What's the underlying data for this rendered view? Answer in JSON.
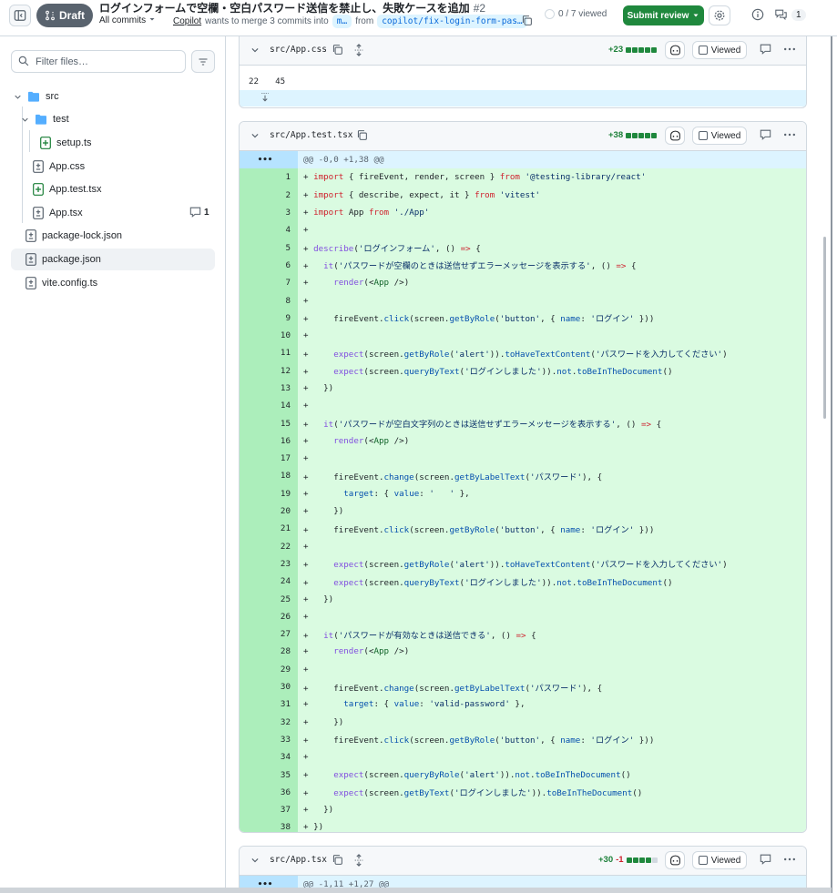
{
  "header": {
    "draft_label": "Draft",
    "title": "ログインフォームで空欄・空白パスワード送信を禁止し、失敗ケースを追加",
    "pr_number": "#2",
    "commits_select": "All commits",
    "author": "Copilot",
    "merge_text": "wants to merge 3 commits into",
    "base_branch": "m…",
    "from_text": "from",
    "head_branch": "copilot/fix-login-form-pas…",
    "viewed_progress": "0 / 7 viewed",
    "submit_review": "Submit review",
    "comment_count": "1"
  },
  "sidebar": {
    "filter_placeholder": "Filter files…",
    "tree": {
      "src": "src",
      "test": "test",
      "setup": "setup.ts",
      "app_css": "App.css",
      "app_test": "App.test.tsx",
      "app_tsx": "App.tsx",
      "app_tsx_comments": "1",
      "package_lock": "package-lock.json",
      "package_json": "package.json",
      "vite_config": "vite.config.ts"
    }
  },
  "files": {
    "css": {
      "name": "src/App.css",
      "additions": "+23",
      "viewed": "Viewed",
      "line_old": "22",
      "line_new": "45"
    },
    "test": {
      "name": "src/App.test.tsx",
      "additions": "+38",
      "viewed": "Viewed",
      "hunk": "@@ -0,0 +1,38 @@",
      "expand": "•••"
    },
    "tsx": {
      "name": "src/App.tsx",
      "additions": "+30",
      "deletions": "-1",
      "viewed": "Viewed",
      "hunk": "@@ -1,11 +1,27 @@",
      "expand": "•••"
    }
  },
  "code_lines": [
    "import { fireEvent, render, screen } from '@testing-library/react'",
    "import { describe, expect, it } from 'vitest'",
    "import App from './App'",
    "",
    "describe('ログインフォーム', () => {",
    "  it('パスワードが空欄のときは送信せずエラーメッセージを表示する', () => {",
    "    render(<App />)",
    "",
    "    fireEvent.click(screen.getByRole('button', { name: 'ログイン' }))",
    "",
    "    expect(screen.getByRole('alert')).toHaveTextContent('パスワードを入力してください')",
    "    expect(screen.queryByText('ログインしました')).not.toBeInTheDocument()",
    "  })",
    "",
    "  it('パスワードが空白文字列のときは送信せずエラーメッセージを表示する', () => {",
    "    render(<App />)",
    "",
    "    fireEvent.change(screen.getByLabelText('パスワード'), {",
    "      target: { value: '   ' },",
    "    })",
    "    fireEvent.click(screen.getByRole('button', { name: 'ログイン' }))",
    "",
    "    expect(screen.getByRole('alert')).toHaveTextContent('パスワードを入力してください')",
    "    expect(screen.queryByText('ログインしました')).not.toBeInTheDocument()",
    "  })",
    "",
    "  it('パスワードが有効なときは送信できる', () => {",
    "    render(<App />)",
    "",
    "    fireEvent.change(screen.getByLabelText('パスワード'), {",
    "      target: { value: 'valid-password' },",
    "    })",
    "    fireEvent.click(screen.getByRole('button', { name: 'ログイン' }))",
    "",
    "    expect(screen.queryByRole('alert')).not.toBeInTheDocument()",
    "    expect(screen.getByText('ログインしました')).toBeInTheDocument()",
    "  })",
    "})"
  ],
  "colors": {
    "add_line_number": "#aceebb",
    "add_line": "#dafbe1",
    "hunk": "#ddf4ff",
    "submit": "#1f883d"
  }
}
